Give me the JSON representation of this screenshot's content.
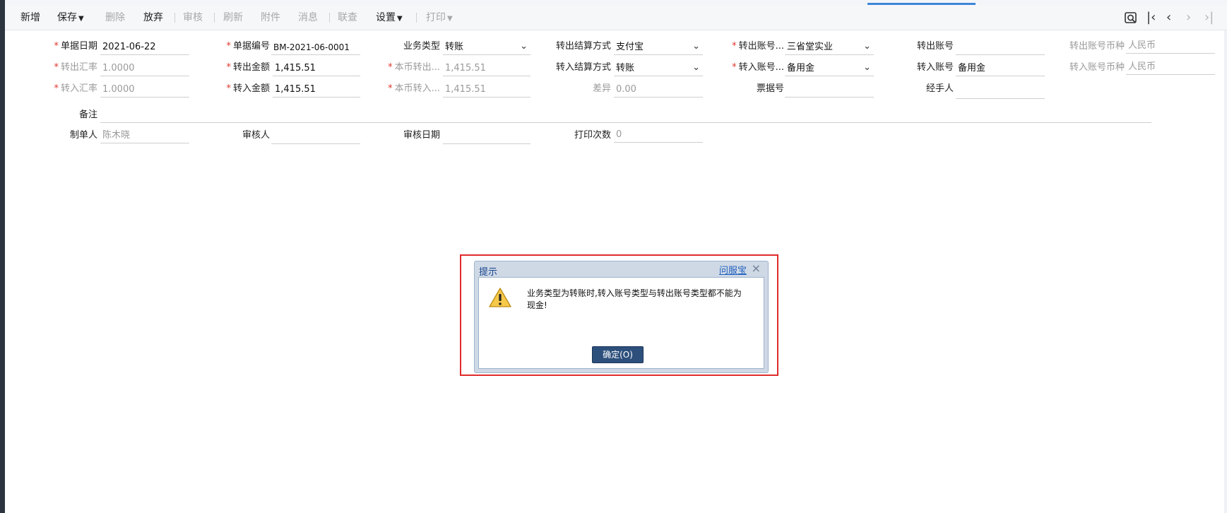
{
  "toolbar": {
    "new": "新增",
    "save": "保存",
    "delete": "删除",
    "discard": "放弃",
    "audit": "审核",
    "refresh": "刷新",
    "attachment": "附件",
    "message": "消息",
    "linked_query": "联查",
    "settings": "设置",
    "print": "打印"
  },
  "form": {
    "doc_date": {
      "label": "单据日期",
      "value": "2021-06-22"
    },
    "doc_no": {
      "label": "单据编号",
      "value": "BM-2021-06-0001"
    },
    "biz_type": {
      "label": "业务类型",
      "value": "转账"
    },
    "out_settle": {
      "label": "转出结算方式",
      "value": "支付宝"
    },
    "out_acct_name": {
      "label": "转出账号...",
      "value": "三省堂实业"
    },
    "out_acct_no": {
      "label": "转出账号",
      "value": ""
    },
    "out_currency": {
      "label": "转出账号币种",
      "value": "人民币"
    },
    "out_rate": {
      "label": "转出汇率",
      "value": "1.0000"
    },
    "out_amount": {
      "label": "转出金额",
      "value": "1,415.51"
    },
    "local_out": {
      "label": "本币转出...",
      "value": "1,415.51"
    },
    "in_settle": {
      "label": "转入结算方式",
      "value": "转账"
    },
    "in_acct_name": {
      "label": "转入账号...",
      "value": "备用金"
    },
    "in_acct_no": {
      "label": "转入账号",
      "value": "备用金"
    },
    "in_currency": {
      "label": "转入账号币种",
      "value": "人民币"
    },
    "in_rate": {
      "label": "转入汇率",
      "value": "1.0000"
    },
    "in_amount": {
      "label": "转入金额",
      "value": "1,415.51"
    },
    "local_in": {
      "label": "本币转入...",
      "value": "1,415.51"
    },
    "diff": {
      "label": "差异",
      "value": "0.00"
    },
    "bill_no": {
      "label": "票据号",
      "value": ""
    },
    "handler": {
      "label": "经手人",
      "value": ""
    },
    "remark": {
      "label": "备注",
      "value": ""
    },
    "creator": {
      "label": "制单人",
      "value": "陈木晓"
    },
    "auditor": {
      "label": "审核人",
      "value": ""
    },
    "audit_date": {
      "label": "审核日期",
      "value": ""
    },
    "print_count": {
      "label": "打印次数",
      "value": "0"
    }
  },
  "dialog": {
    "title": "提示",
    "help_link": "问服宝",
    "message": "业务类型为转账时,转入账号类型与转出账号类型都不能为现金!",
    "ok_label": "确定(O)"
  },
  "colors": {
    "accent": "#3d86d8",
    "highlight": "#e02b2b",
    "required": "#e0362c",
    "ok_button": "#2d4f7c"
  }
}
